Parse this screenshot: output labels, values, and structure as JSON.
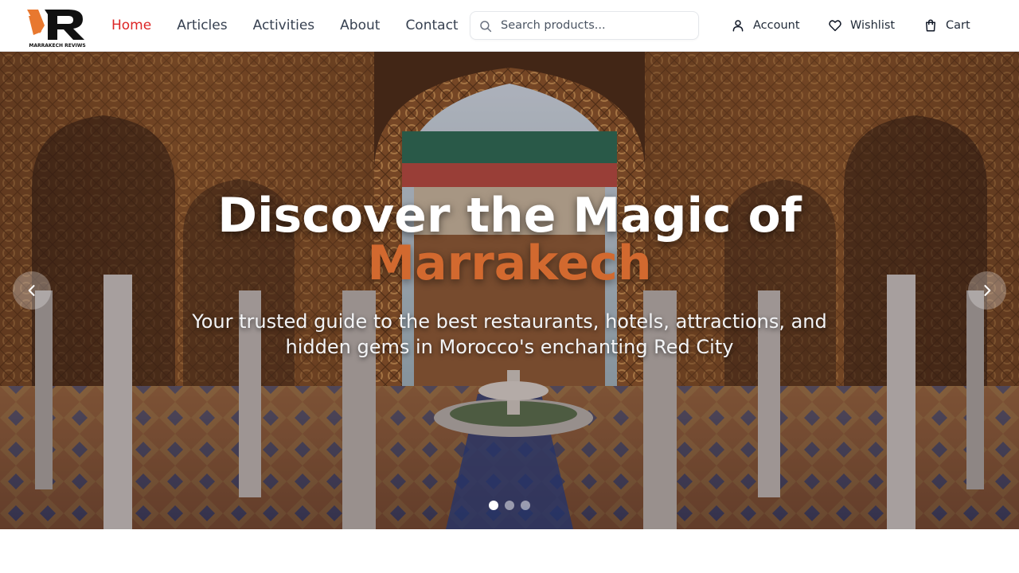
{
  "brand": {
    "logo_text": "MARRAKECH REVIWS",
    "accent_color": "#e8782f"
  },
  "nav": {
    "items": [
      {
        "label": "Home",
        "active": true
      },
      {
        "label": "Articles",
        "active": false
      },
      {
        "label": "Activities",
        "active": false
      },
      {
        "label": "About",
        "active": false
      },
      {
        "label": "Contact",
        "active": false
      }
    ],
    "active_color": "#dc2626"
  },
  "search": {
    "placeholder": "Search products...",
    "value": "",
    "icon": "search-icon"
  },
  "actions": {
    "account": {
      "label": "Account",
      "icon": "user-icon"
    },
    "wishlist": {
      "label": "Wishlist",
      "icon": "heart-icon"
    },
    "cart": {
      "label": "Cart",
      "icon": "shopping-bag-icon"
    }
  },
  "hero": {
    "title": "Discover the Magic of",
    "title_accent": "Marrakech",
    "accent_color": "#d2692f",
    "subtitle": "Your trusted guide to the best restaurants, hotels, attractions, and hidden gems in Morocco's enchanting Red City",
    "prev_icon": "chevron-left-icon",
    "next_icon": "chevron-right-icon",
    "slides_total": 3,
    "active_slide": 1
  }
}
